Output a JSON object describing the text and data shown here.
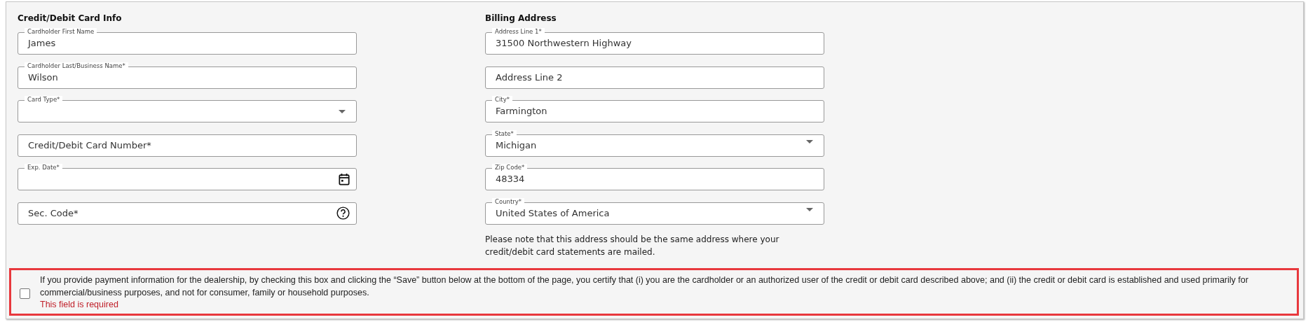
{
  "card_info": {
    "heading": "Credit/Debit Card Info",
    "fields": [
      {
        "kind": "text",
        "label": "Cardholder First Name",
        "value": "James"
      },
      {
        "kind": "text",
        "label": "Cardholder Last/Business Name*",
        "value": "Wilson"
      },
      {
        "kind": "select",
        "label": "Card Type*"
      },
      {
        "kind": "text",
        "placeholder": "Credit/Debit Card Number*"
      },
      {
        "kind": "date",
        "label": "Exp. Date*"
      },
      {
        "kind": "help",
        "placeholder": "Sec. Code*"
      }
    ]
  },
  "billing_address": {
    "heading": "Billing Address",
    "fields": [
      {
        "kind": "text",
        "label": "Address Line 1*",
        "value": "31500 Northwestern Highway"
      },
      {
        "kind": "text",
        "placeholder": "Address Line 2"
      },
      {
        "kind": "text",
        "label": "City*",
        "value": "Farmington"
      },
      {
        "kind": "select",
        "label": "State*",
        "value": "Michigan"
      },
      {
        "kind": "text",
        "label": "Zip Code*",
        "value": "48334"
      },
      {
        "kind": "select",
        "label": "Country*",
        "value": "United States of America"
      }
    ],
    "note": "Please note that this address should be the same address where your credit/debit card statements are mailed."
  },
  "certification": {
    "checked": false,
    "text": "If you provide payment information for the dealership, by checking this box and clicking the “Save” button below at the bottom of the page, you certify that (i) you are the cardholder or an authorized user of the credit or debit card described above; and (ii) the credit or debit card is established and used primarily for commercial/business purposes, and not for consumer, family or household purposes.",
    "error": "This field is required"
  }
}
